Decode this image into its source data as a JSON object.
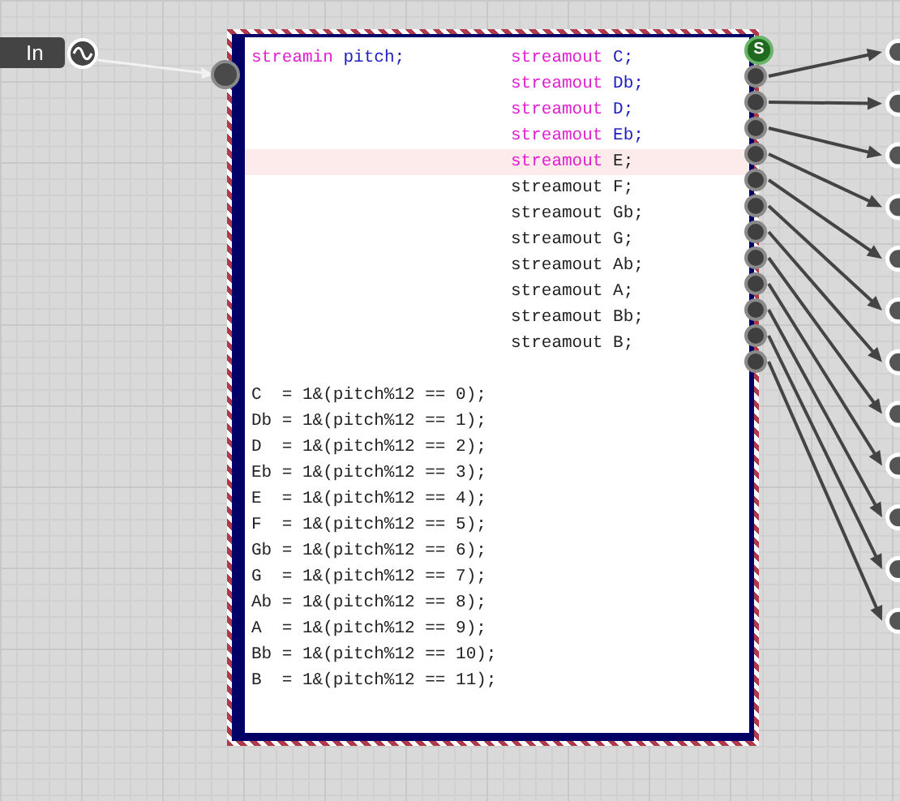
{
  "input_node": {
    "label": "In"
  },
  "code_node": {
    "state_port_label": "S",
    "input_declaration": {
      "keyword": "streamin",
      "name": "pitch;"
    },
    "declarations": [
      {
        "keyword": "streamout",
        "name": "C;",
        "keyword_colored": true,
        "name_colored": true,
        "selected": false
      },
      {
        "keyword": "streamout",
        "name": "Db;",
        "keyword_colored": true,
        "name_colored": true,
        "selected": false
      },
      {
        "keyword": "streamout",
        "name": "D;",
        "keyword_colored": true,
        "name_colored": true,
        "selected": false
      },
      {
        "keyword": "streamout",
        "name": "Eb;",
        "keyword_colored": true,
        "name_colored": true,
        "selected": false
      },
      {
        "keyword": "streamout",
        "name": "E;",
        "keyword_colored": true,
        "name_colored": false,
        "selected": true
      },
      {
        "keyword": "streamout",
        "name": "F;",
        "keyword_colored": false,
        "name_colored": false,
        "selected": false
      },
      {
        "keyword": "streamout",
        "name": "Gb;",
        "keyword_colored": false,
        "name_colored": false,
        "selected": false
      },
      {
        "keyword": "streamout",
        "name": "G;",
        "keyword_colored": false,
        "name_colored": false,
        "selected": false
      },
      {
        "keyword": "streamout",
        "name": "Ab;",
        "keyword_colored": false,
        "name_colored": false,
        "selected": false
      },
      {
        "keyword": "streamout",
        "name": "A;",
        "keyword_colored": false,
        "name_colored": false,
        "selected": false
      },
      {
        "keyword": "streamout",
        "name": "Bb;",
        "keyword_colored": false,
        "name_colored": false,
        "selected": false
      },
      {
        "keyword": "streamout",
        "name": "B;",
        "keyword_colored": false,
        "name_colored": false,
        "selected": false
      }
    ],
    "assignments": [
      "C  = 1&(pitch%12 == 0);",
      "Db = 1&(pitch%12 == 1);",
      "D  = 1&(pitch%12 == 2);",
      "Eb = 1&(pitch%12 == 3);",
      "E  = 1&(pitch%12 == 4);",
      "F  = 1&(pitch%12 == 5);",
      "Gb = 1&(pitch%12 == 6);",
      "G  = 1&(pitch%12 == 7);",
      "Ab = 1&(pitch%12 == 8);",
      "A  = 1&(pitch%12 == 9);",
      "Bb = 1&(pitch%12 == 10);",
      "B  = 1&(pitch%12 == 11);"
    ]
  }
}
